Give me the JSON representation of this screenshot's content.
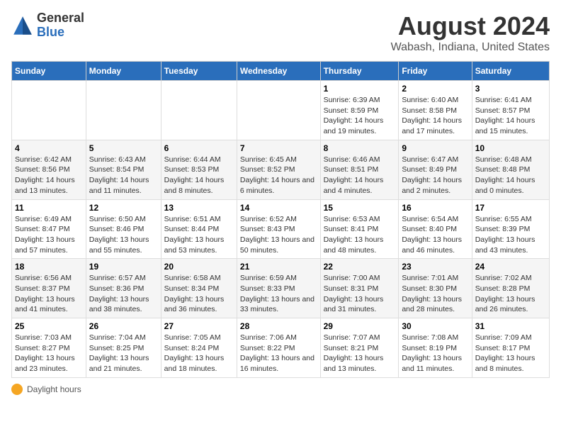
{
  "logo": {
    "general": "General",
    "blue": "Blue"
  },
  "title": "August 2024",
  "subtitle": "Wabash, Indiana, United States",
  "days_of_week": [
    "Sunday",
    "Monday",
    "Tuesday",
    "Wednesday",
    "Thursday",
    "Friday",
    "Saturday"
  ],
  "footer_label": "Daylight hours",
  "weeks": [
    [
      {
        "num": "",
        "info": ""
      },
      {
        "num": "",
        "info": ""
      },
      {
        "num": "",
        "info": ""
      },
      {
        "num": "",
        "info": ""
      },
      {
        "num": "1",
        "info": "Sunrise: 6:39 AM\nSunset: 8:59 PM\nDaylight: 14 hours and 19 minutes."
      },
      {
        "num": "2",
        "info": "Sunrise: 6:40 AM\nSunset: 8:58 PM\nDaylight: 14 hours and 17 minutes."
      },
      {
        "num": "3",
        "info": "Sunrise: 6:41 AM\nSunset: 8:57 PM\nDaylight: 14 hours and 15 minutes."
      }
    ],
    [
      {
        "num": "4",
        "info": "Sunrise: 6:42 AM\nSunset: 8:56 PM\nDaylight: 14 hours and 13 minutes."
      },
      {
        "num": "5",
        "info": "Sunrise: 6:43 AM\nSunset: 8:54 PM\nDaylight: 14 hours and 11 minutes."
      },
      {
        "num": "6",
        "info": "Sunrise: 6:44 AM\nSunset: 8:53 PM\nDaylight: 14 hours and 8 minutes."
      },
      {
        "num": "7",
        "info": "Sunrise: 6:45 AM\nSunset: 8:52 PM\nDaylight: 14 hours and 6 minutes."
      },
      {
        "num": "8",
        "info": "Sunrise: 6:46 AM\nSunset: 8:51 PM\nDaylight: 14 hours and 4 minutes."
      },
      {
        "num": "9",
        "info": "Sunrise: 6:47 AM\nSunset: 8:49 PM\nDaylight: 14 hours and 2 minutes."
      },
      {
        "num": "10",
        "info": "Sunrise: 6:48 AM\nSunset: 8:48 PM\nDaylight: 14 hours and 0 minutes."
      }
    ],
    [
      {
        "num": "11",
        "info": "Sunrise: 6:49 AM\nSunset: 8:47 PM\nDaylight: 13 hours and 57 minutes."
      },
      {
        "num": "12",
        "info": "Sunrise: 6:50 AM\nSunset: 8:46 PM\nDaylight: 13 hours and 55 minutes."
      },
      {
        "num": "13",
        "info": "Sunrise: 6:51 AM\nSunset: 8:44 PM\nDaylight: 13 hours and 53 minutes."
      },
      {
        "num": "14",
        "info": "Sunrise: 6:52 AM\nSunset: 8:43 PM\nDaylight: 13 hours and 50 minutes."
      },
      {
        "num": "15",
        "info": "Sunrise: 6:53 AM\nSunset: 8:41 PM\nDaylight: 13 hours and 48 minutes."
      },
      {
        "num": "16",
        "info": "Sunrise: 6:54 AM\nSunset: 8:40 PM\nDaylight: 13 hours and 46 minutes."
      },
      {
        "num": "17",
        "info": "Sunrise: 6:55 AM\nSunset: 8:39 PM\nDaylight: 13 hours and 43 minutes."
      }
    ],
    [
      {
        "num": "18",
        "info": "Sunrise: 6:56 AM\nSunset: 8:37 PM\nDaylight: 13 hours and 41 minutes."
      },
      {
        "num": "19",
        "info": "Sunrise: 6:57 AM\nSunset: 8:36 PM\nDaylight: 13 hours and 38 minutes."
      },
      {
        "num": "20",
        "info": "Sunrise: 6:58 AM\nSunset: 8:34 PM\nDaylight: 13 hours and 36 minutes."
      },
      {
        "num": "21",
        "info": "Sunrise: 6:59 AM\nSunset: 8:33 PM\nDaylight: 13 hours and 33 minutes."
      },
      {
        "num": "22",
        "info": "Sunrise: 7:00 AM\nSunset: 8:31 PM\nDaylight: 13 hours and 31 minutes."
      },
      {
        "num": "23",
        "info": "Sunrise: 7:01 AM\nSunset: 8:30 PM\nDaylight: 13 hours and 28 minutes."
      },
      {
        "num": "24",
        "info": "Sunrise: 7:02 AM\nSunset: 8:28 PM\nDaylight: 13 hours and 26 minutes."
      }
    ],
    [
      {
        "num": "25",
        "info": "Sunrise: 7:03 AM\nSunset: 8:27 PM\nDaylight: 13 hours and 23 minutes."
      },
      {
        "num": "26",
        "info": "Sunrise: 7:04 AM\nSunset: 8:25 PM\nDaylight: 13 hours and 21 minutes."
      },
      {
        "num": "27",
        "info": "Sunrise: 7:05 AM\nSunset: 8:24 PM\nDaylight: 13 hours and 18 minutes."
      },
      {
        "num": "28",
        "info": "Sunrise: 7:06 AM\nSunset: 8:22 PM\nDaylight: 13 hours and 16 minutes."
      },
      {
        "num": "29",
        "info": "Sunrise: 7:07 AM\nSunset: 8:21 PM\nDaylight: 13 hours and 13 minutes."
      },
      {
        "num": "30",
        "info": "Sunrise: 7:08 AM\nSunset: 8:19 PM\nDaylight: 13 hours and 11 minutes."
      },
      {
        "num": "31",
        "info": "Sunrise: 7:09 AM\nSunset: 8:17 PM\nDaylight: 13 hours and 8 minutes."
      }
    ]
  ]
}
